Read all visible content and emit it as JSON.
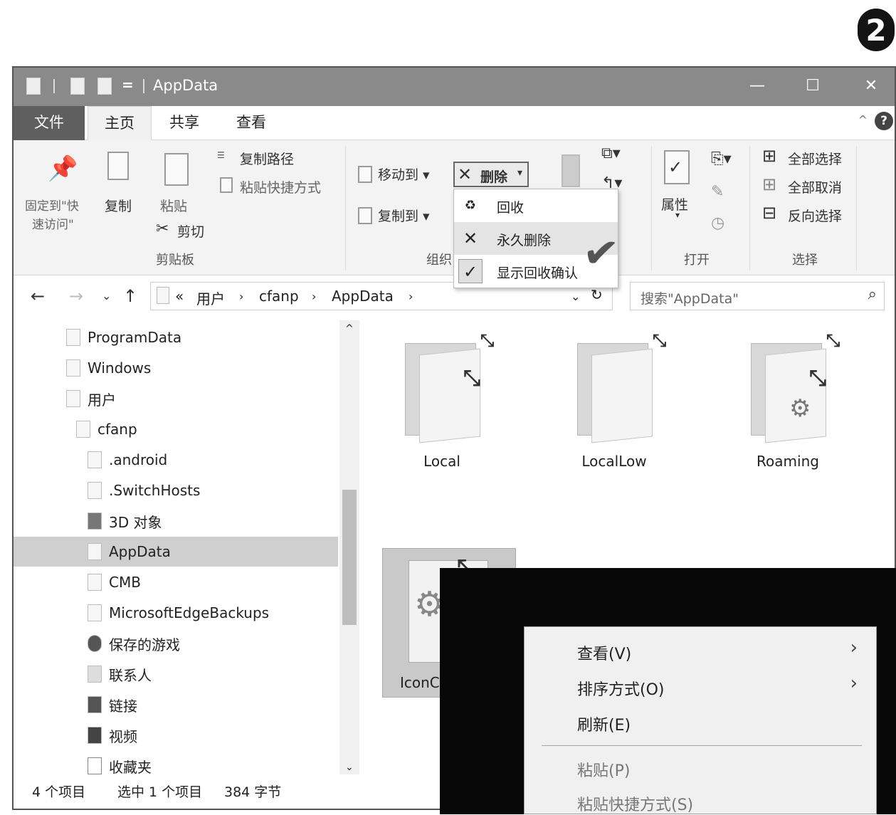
{
  "step_badge": "2",
  "window": {
    "title": "AppData",
    "qat_eq": "="
  },
  "ribbon_tabs": [
    "文件",
    "主页",
    "共享",
    "查看"
  ],
  "ribbon": {
    "pin_label_1": "固定到\"快",
    "pin_label_2": "速访问\"",
    "copy": "复制",
    "paste": "粘贴",
    "copy_path": "复制路径",
    "paste_shortcut": "粘贴快捷方式",
    "cut": "剪切",
    "clipboard_group": "剪贴板",
    "move_to": "移动到",
    "copy_to": "复制到",
    "delete": "删除",
    "organize_group": "组织",
    "properties": "属性",
    "open_group": "打开",
    "select_all": "全部选择",
    "select_none": "全部取消",
    "invert_selection": "反向选择",
    "select_group": "选择"
  },
  "delete_menu": {
    "items": [
      {
        "label": "回收",
        "icon": "recycle-icon"
      },
      {
        "label": "永久删除",
        "icon": "x-icon"
      },
      {
        "label": "显示回收确认",
        "icon": "check-icon",
        "checked": true
      }
    ]
  },
  "address": {
    "prefix": "«",
    "crumbs": [
      "用户",
      "cfanp",
      "AppData"
    ],
    "search_placeholder": "搜索\"AppData\""
  },
  "nav_tree": [
    {
      "label": "ProgramData",
      "icon": "folder-icon"
    },
    {
      "label": "Windows",
      "icon": "folder-icon"
    },
    {
      "label": "用户",
      "icon": "folder-icon"
    },
    {
      "label": "cfanp",
      "icon": "folder-icon"
    },
    {
      "label": ".android",
      "icon": "folder-icon"
    },
    {
      "label": ".SwitchHosts",
      "icon": "folder-icon"
    },
    {
      "label": "3D 对象",
      "icon": "3d-objects-icon"
    },
    {
      "label": "AppData",
      "icon": "folder-icon",
      "selected": true
    },
    {
      "label": "CMB",
      "icon": "folder-icon"
    },
    {
      "label": "MicrosoftEdgeBackups",
      "icon": "folder-icon"
    },
    {
      "label": "保存的游戏",
      "icon": "saved-games-icon"
    },
    {
      "label": "联系人",
      "icon": "contacts-icon"
    },
    {
      "label": "链接",
      "icon": "links-icon"
    },
    {
      "label": "视频",
      "icon": "videos-icon"
    },
    {
      "label": "收藏夹",
      "icon": "favorites-icon"
    }
  ],
  "folders": [
    {
      "label": "Local"
    },
    {
      "label": "LocalLow"
    },
    {
      "label": "Roaming"
    },
    {
      "label": "IconC"
    }
  ],
  "status": {
    "count": "4 个项目",
    "selection": "选中 1 个项目",
    "size": "384 字节"
  },
  "context_menu": {
    "items": [
      {
        "label": "查看(V)",
        "submenu": true
      },
      {
        "label": "排序方式(O)",
        "submenu": true
      },
      {
        "label": "刷新(E)"
      },
      {
        "label": "粘贴(P)",
        "disabled": true
      },
      {
        "label": "粘贴快捷方式(S)",
        "disabled": true
      }
    ]
  }
}
